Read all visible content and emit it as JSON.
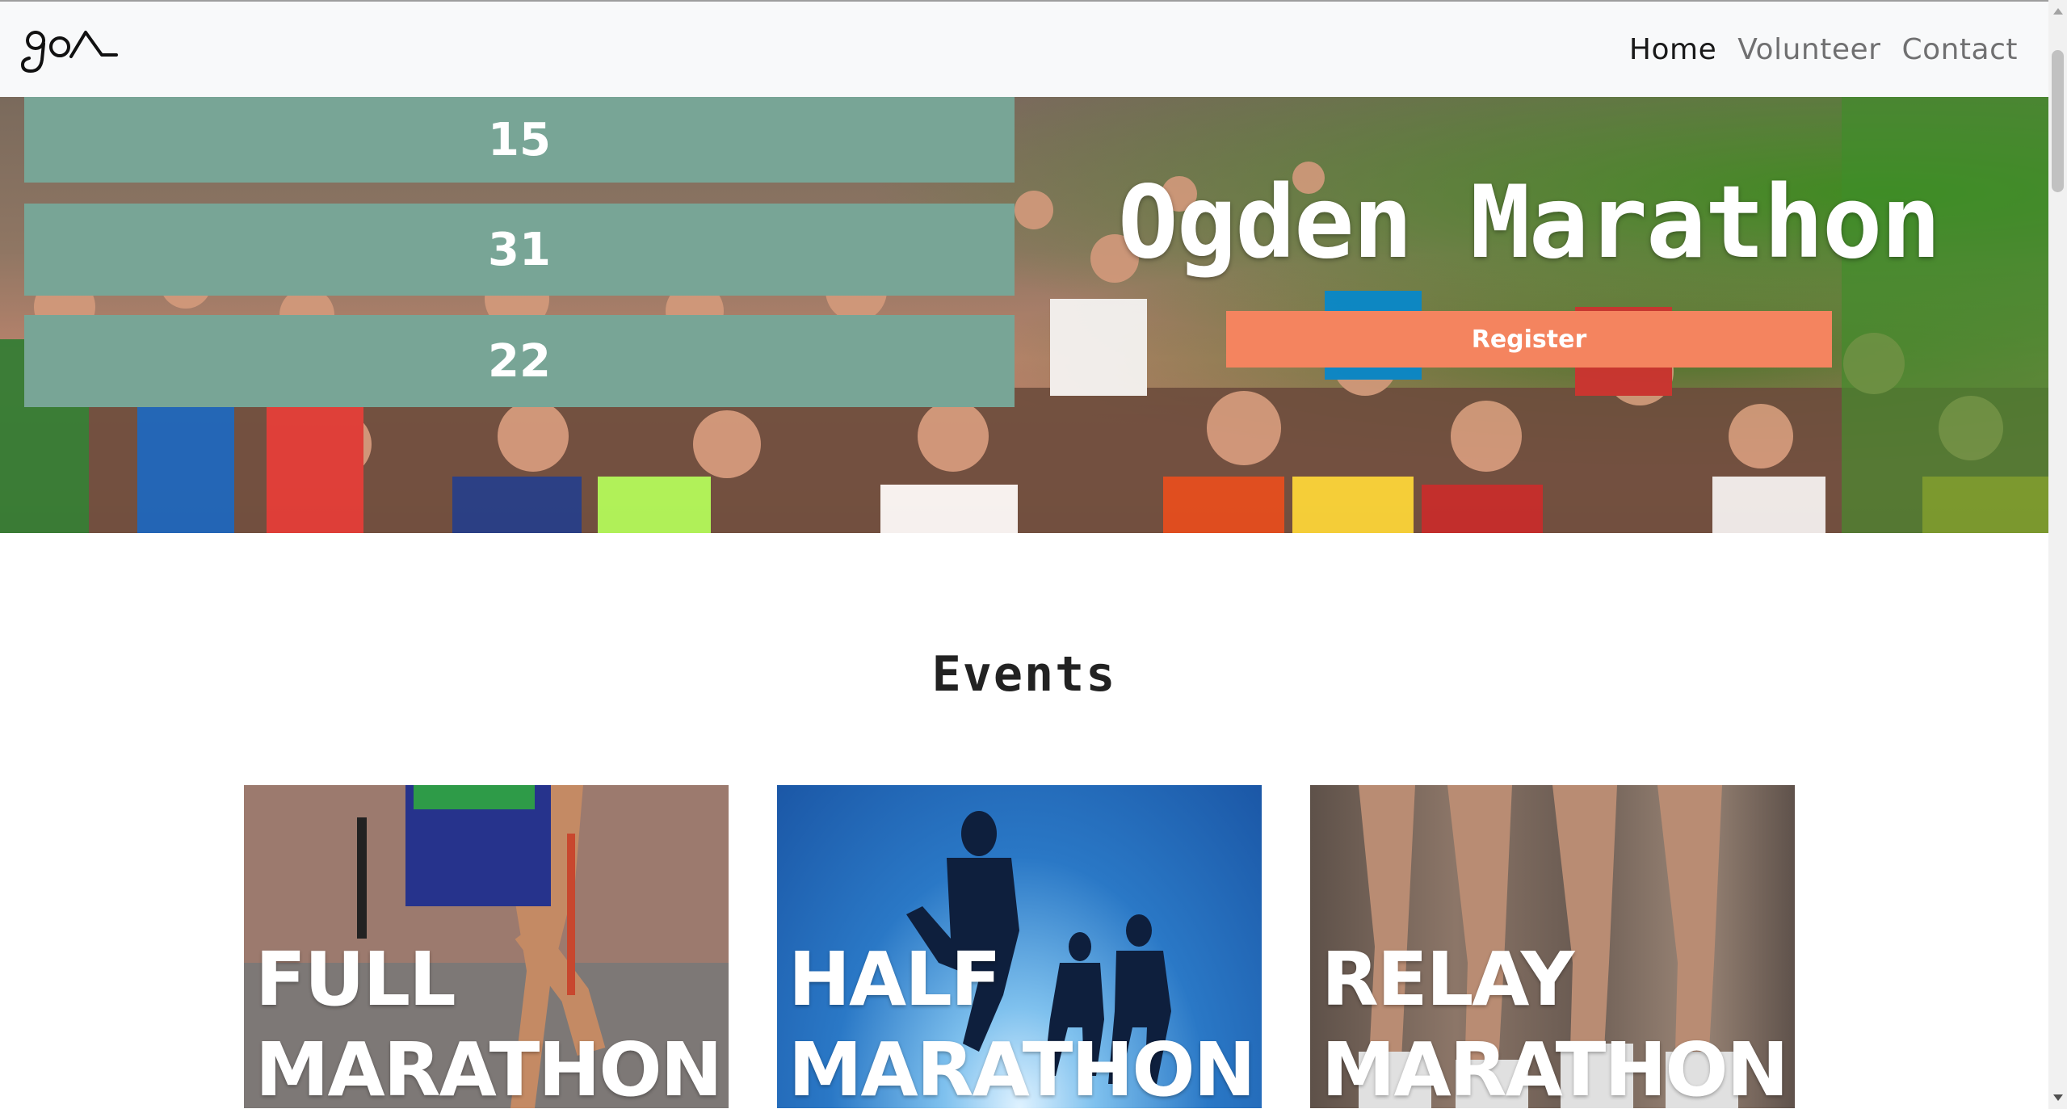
{
  "brand": {
    "logo_text": "goA"
  },
  "nav": {
    "items": [
      {
        "label": "Home",
        "active": true
      },
      {
        "label": "Volunteer",
        "active": false
      },
      {
        "label": "Contact",
        "active": false
      }
    ]
  },
  "hero": {
    "counters": [
      "15",
      "31",
      "22"
    ],
    "title": "Ogden Marathon",
    "register_label": "Register"
  },
  "events": {
    "heading": "Events",
    "cards": [
      {
        "title": "FULL\nMARATHON"
      },
      {
        "title": "HALF\nMARATHON"
      },
      {
        "title": "RELAY\nMARATHON"
      }
    ]
  },
  "colors": {
    "counter_bg": "#78a596",
    "register_bg": "#f4845f",
    "navbar_bg": "#f8f9fa"
  }
}
